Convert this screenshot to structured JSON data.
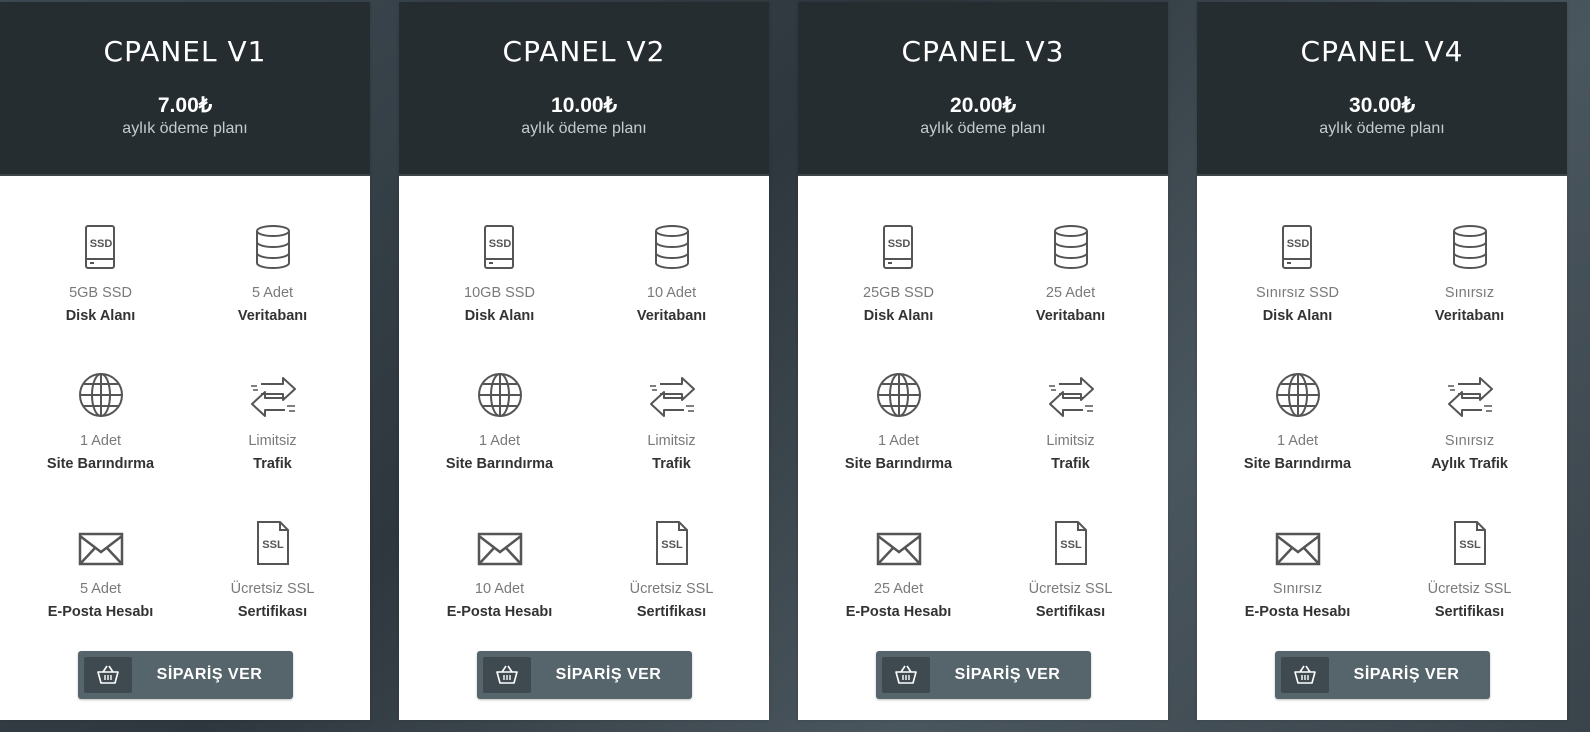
{
  "colors": {
    "header_bg": "#252d31",
    "button_bg": "#56646b",
    "button_icon_bg": "#3f4a50",
    "value_text": "#7a7a7a",
    "label_text": "#333333"
  },
  "plans": [
    {
      "title": "CPANEL V1",
      "price": "7.00₺",
      "period": "aylık ödeme planı",
      "features": [
        {
          "icon": "ssd-icon",
          "value": "5GB SSD",
          "label": "Disk Alanı"
        },
        {
          "icon": "database-icon",
          "value": "5 Adet",
          "label": "Veritabanı"
        },
        {
          "icon": "globe-icon",
          "value": "1 Adet",
          "label": "Site Barındırma"
        },
        {
          "icon": "transfer-arrows-icon",
          "value": "Limitsiz",
          "label": "Trafik"
        },
        {
          "icon": "envelope-icon",
          "value": "5 Adet",
          "label": "E-Posta Hesabı"
        },
        {
          "icon": "ssl-file-icon",
          "value": "Ücretsiz SSL",
          "label": "Sertifikası"
        }
      ],
      "button": "SİPARİŞ VER"
    },
    {
      "title": "CPANEL V2",
      "price": "10.00₺",
      "period": "aylık ödeme planı",
      "features": [
        {
          "icon": "ssd-icon",
          "value": "10GB SSD",
          "label": "Disk Alanı"
        },
        {
          "icon": "database-icon",
          "value": "10 Adet",
          "label": "Veritabanı"
        },
        {
          "icon": "globe-icon",
          "value": "1 Adet",
          "label": "Site Barındırma"
        },
        {
          "icon": "transfer-arrows-icon",
          "value": "Limitsiz",
          "label": "Trafik"
        },
        {
          "icon": "envelope-icon",
          "value": "10 Adet",
          "label": "E-Posta Hesabı"
        },
        {
          "icon": "ssl-file-icon",
          "value": "Ücretsiz SSL",
          "label": "Sertifikası"
        }
      ],
      "button": "SİPARİŞ VER"
    },
    {
      "title": "CPANEL V3",
      "price": "20.00₺",
      "period": "aylık ödeme planı",
      "features": [
        {
          "icon": "ssd-icon",
          "value": "25GB SSD",
          "label": "Disk Alanı"
        },
        {
          "icon": "database-icon",
          "value": "25 Adet",
          "label": "Veritabanı"
        },
        {
          "icon": "globe-icon",
          "value": "1 Adet",
          "label": "Site Barındırma"
        },
        {
          "icon": "transfer-arrows-icon",
          "value": "Limitsiz",
          "label": "Trafik"
        },
        {
          "icon": "envelope-icon",
          "value": "25 Adet",
          "label": "E-Posta Hesabı"
        },
        {
          "icon": "ssl-file-icon",
          "value": "Ücretsiz SSL",
          "label": "Sertifikası"
        }
      ],
      "button": "SİPARİŞ VER"
    },
    {
      "title": "CPANEL V4",
      "price": "30.00₺",
      "period": "aylık ödeme planı",
      "features": [
        {
          "icon": "ssd-icon",
          "value": "Sınırsız SSD",
          "label": "Disk Alanı"
        },
        {
          "icon": "database-icon",
          "value": "Sınırsız",
          "label": "Veritabanı"
        },
        {
          "icon": "globe-icon",
          "value": "1 Adet",
          "label": "Site Barındırma"
        },
        {
          "icon": "transfer-arrows-icon",
          "value": "Sınırsız",
          "label": "Aylık Trafik"
        },
        {
          "icon": "envelope-icon",
          "value": "Sınırsız",
          "label": "E-Posta Hesabı"
        },
        {
          "icon": "ssl-file-icon",
          "value": "Ücretsiz SSL",
          "label": "Sertifikası"
        }
      ],
      "button": "SİPARİŞ VER"
    }
  ]
}
